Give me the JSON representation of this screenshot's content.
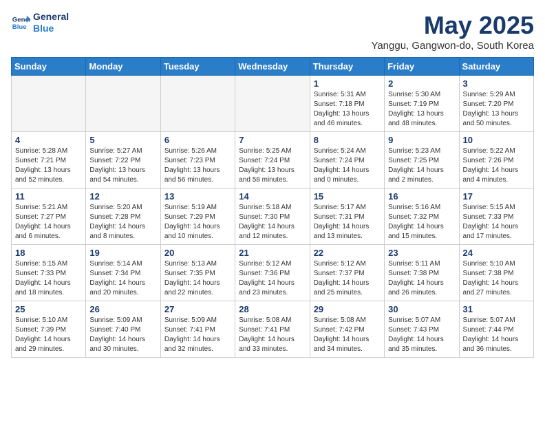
{
  "header": {
    "logo_line1": "General",
    "logo_line2": "Blue",
    "month_year": "May 2025",
    "location": "Yanggu, Gangwon-do, South Korea"
  },
  "weekdays": [
    "Sunday",
    "Monday",
    "Tuesday",
    "Wednesday",
    "Thursday",
    "Friday",
    "Saturday"
  ],
  "weeks": [
    [
      {
        "day": "",
        "info": ""
      },
      {
        "day": "",
        "info": ""
      },
      {
        "day": "",
        "info": ""
      },
      {
        "day": "",
        "info": ""
      },
      {
        "day": "1",
        "info": "Sunrise: 5:31 AM\nSunset: 7:18 PM\nDaylight: 13 hours\nand 46 minutes."
      },
      {
        "day": "2",
        "info": "Sunrise: 5:30 AM\nSunset: 7:19 PM\nDaylight: 13 hours\nand 48 minutes."
      },
      {
        "day": "3",
        "info": "Sunrise: 5:29 AM\nSunset: 7:20 PM\nDaylight: 13 hours\nand 50 minutes."
      }
    ],
    [
      {
        "day": "4",
        "info": "Sunrise: 5:28 AM\nSunset: 7:21 PM\nDaylight: 13 hours\nand 52 minutes."
      },
      {
        "day": "5",
        "info": "Sunrise: 5:27 AM\nSunset: 7:22 PM\nDaylight: 13 hours\nand 54 minutes."
      },
      {
        "day": "6",
        "info": "Sunrise: 5:26 AM\nSunset: 7:23 PM\nDaylight: 13 hours\nand 56 minutes."
      },
      {
        "day": "7",
        "info": "Sunrise: 5:25 AM\nSunset: 7:24 PM\nDaylight: 13 hours\nand 58 minutes."
      },
      {
        "day": "8",
        "info": "Sunrise: 5:24 AM\nSunset: 7:24 PM\nDaylight: 14 hours\nand 0 minutes."
      },
      {
        "day": "9",
        "info": "Sunrise: 5:23 AM\nSunset: 7:25 PM\nDaylight: 14 hours\nand 2 minutes."
      },
      {
        "day": "10",
        "info": "Sunrise: 5:22 AM\nSunset: 7:26 PM\nDaylight: 14 hours\nand 4 minutes."
      }
    ],
    [
      {
        "day": "11",
        "info": "Sunrise: 5:21 AM\nSunset: 7:27 PM\nDaylight: 14 hours\nand 6 minutes."
      },
      {
        "day": "12",
        "info": "Sunrise: 5:20 AM\nSunset: 7:28 PM\nDaylight: 14 hours\nand 8 minutes."
      },
      {
        "day": "13",
        "info": "Sunrise: 5:19 AM\nSunset: 7:29 PM\nDaylight: 14 hours\nand 10 minutes."
      },
      {
        "day": "14",
        "info": "Sunrise: 5:18 AM\nSunset: 7:30 PM\nDaylight: 14 hours\nand 12 minutes."
      },
      {
        "day": "15",
        "info": "Sunrise: 5:17 AM\nSunset: 7:31 PM\nDaylight: 14 hours\nand 13 minutes."
      },
      {
        "day": "16",
        "info": "Sunrise: 5:16 AM\nSunset: 7:32 PM\nDaylight: 14 hours\nand 15 minutes."
      },
      {
        "day": "17",
        "info": "Sunrise: 5:15 AM\nSunset: 7:33 PM\nDaylight: 14 hours\nand 17 minutes."
      }
    ],
    [
      {
        "day": "18",
        "info": "Sunrise: 5:15 AM\nSunset: 7:33 PM\nDaylight: 14 hours\nand 18 minutes."
      },
      {
        "day": "19",
        "info": "Sunrise: 5:14 AM\nSunset: 7:34 PM\nDaylight: 14 hours\nand 20 minutes."
      },
      {
        "day": "20",
        "info": "Sunrise: 5:13 AM\nSunset: 7:35 PM\nDaylight: 14 hours\nand 22 minutes."
      },
      {
        "day": "21",
        "info": "Sunrise: 5:12 AM\nSunset: 7:36 PM\nDaylight: 14 hours\nand 23 minutes."
      },
      {
        "day": "22",
        "info": "Sunrise: 5:12 AM\nSunset: 7:37 PM\nDaylight: 14 hours\nand 25 minutes."
      },
      {
        "day": "23",
        "info": "Sunrise: 5:11 AM\nSunset: 7:38 PM\nDaylight: 14 hours\nand 26 minutes."
      },
      {
        "day": "24",
        "info": "Sunrise: 5:10 AM\nSunset: 7:38 PM\nDaylight: 14 hours\nand 27 minutes."
      }
    ],
    [
      {
        "day": "25",
        "info": "Sunrise: 5:10 AM\nSunset: 7:39 PM\nDaylight: 14 hours\nand 29 minutes."
      },
      {
        "day": "26",
        "info": "Sunrise: 5:09 AM\nSunset: 7:40 PM\nDaylight: 14 hours\nand 30 minutes."
      },
      {
        "day": "27",
        "info": "Sunrise: 5:09 AM\nSunset: 7:41 PM\nDaylight: 14 hours\nand 32 minutes."
      },
      {
        "day": "28",
        "info": "Sunrise: 5:08 AM\nSunset: 7:41 PM\nDaylight: 14 hours\nand 33 minutes."
      },
      {
        "day": "29",
        "info": "Sunrise: 5:08 AM\nSunset: 7:42 PM\nDaylight: 14 hours\nand 34 minutes."
      },
      {
        "day": "30",
        "info": "Sunrise: 5:07 AM\nSunset: 7:43 PM\nDaylight: 14 hours\nand 35 minutes."
      },
      {
        "day": "31",
        "info": "Sunrise: 5:07 AM\nSunset: 7:44 PM\nDaylight: 14 hours\nand 36 minutes."
      }
    ]
  ]
}
